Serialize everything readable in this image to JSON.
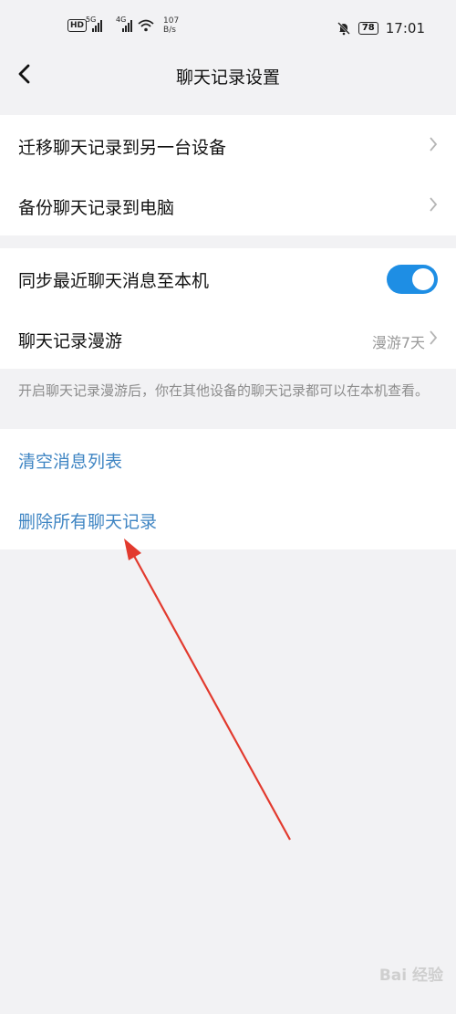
{
  "status_bar": {
    "hd": "HD",
    "net1": "5G",
    "net2": "4G",
    "speed_value": "107",
    "speed_unit": "B/s",
    "battery": "78",
    "time": "17:01"
  },
  "header": {
    "title": "聊天记录设置"
  },
  "group1": {
    "migrate": "迁移聊天记录到另一台设备",
    "backup": "备份聊天记录到电脑"
  },
  "group2": {
    "sync_label": "同步最近聊天消息至本机",
    "sync_enabled": true,
    "roam_label": "聊天记录漫游",
    "roam_value": "漫游7天"
  },
  "note": "开启聊天记录漫游后，你在其他设备的聊天记录都可以在本机查看。",
  "group3": {
    "clear": "清空消息列表",
    "delete_all": "删除所有聊天记录"
  },
  "colors": {
    "accent": "#1e8ee4",
    "link": "#3f85c3",
    "arrow": "#e23a2e"
  },
  "watermark": "Bai 经验"
}
